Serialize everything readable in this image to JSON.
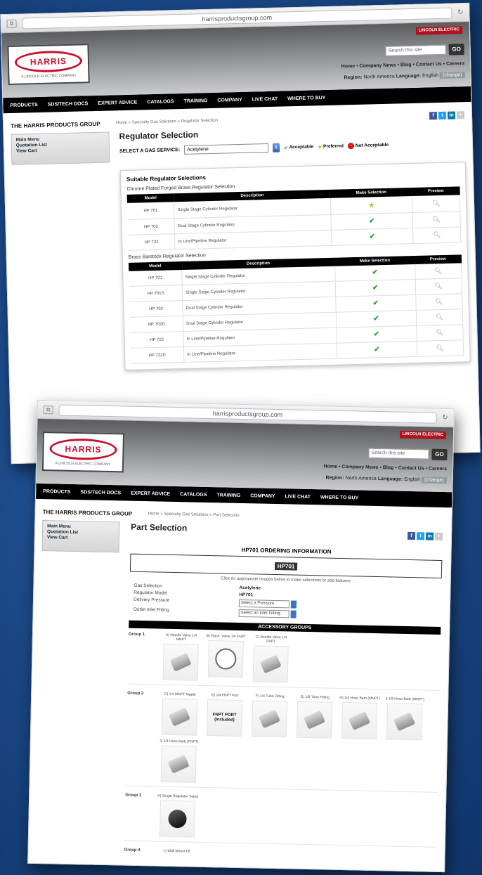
{
  "shot1": {
    "url": "harrisproductsgroup.com",
    "brand": {
      "logo": "HARRIS",
      "tagline": "A LINCOLN ELECTRIC COMPANY",
      "partner": "LINCOLN ELECTRIC"
    },
    "search": {
      "placeholder": "Search this site",
      "go": "GO"
    },
    "toplinks": "Home  •  Company News  •  Blog  •  Contact Us  •  Careers",
    "region": {
      "label": "Region:",
      "value": "North America",
      "lang_label": "Language:",
      "lang_value": "English",
      "change": "(change)"
    },
    "nav": [
      "PRODUCTS",
      "SDS/TECH DOCS",
      "EXPERT ADVICE",
      "CATALOGS",
      "TRAINING",
      "COMPANY",
      "LIVE CHAT",
      "WHERE TO BUY"
    ],
    "site_name": "THE HARRIS PRODUCTS GROUP",
    "breadcrumb": "Home » Specialty Gas Solutions » Regulator Selection",
    "sidebar": [
      "Main Menu",
      "Quotation List",
      "View Cart"
    ],
    "page_title": "Regulator Selection",
    "gas": {
      "label": "SELECT A GAS SERVICE:",
      "value": "Acetylene"
    },
    "legend": {
      "acceptable": "Acceptable",
      "preferred": "Preferred",
      "not_acceptable": "Not Acceptable"
    },
    "results_title": "Suitable Regulator Selections",
    "table_headers": [
      "Model",
      "Description",
      "Make Selection",
      "Preview"
    ],
    "sections": [
      {
        "title": "Chrome Plated Forged Brass Regulator Selection",
        "rows": [
          {
            "model": "HP 701",
            "desc": "Single Stage Cylinder Regulator",
            "mark": "preferred"
          },
          {
            "model": "HP 702",
            "desc": "Dual Stage Cylinder Regulator",
            "mark": "acceptable"
          },
          {
            "model": "HP 722",
            "desc": "In Line/Pipeline Regulator",
            "mark": "acceptable"
          }
        ]
      },
      {
        "title": "Brass Barstock Regulator Selection",
        "rows": [
          {
            "model": "HP 701",
            "desc": "Single Stage Cylinder Regulator",
            "mark": "acceptable"
          },
          {
            "model": "HP 701S",
            "desc": "Single Stage Cylinder Regulator",
            "mark": "acceptable"
          },
          {
            "model": "HP 702",
            "desc": "Dual Stage Cylinder Regulator",
            "mark": "acceptable"
          },
          {
            "model": "HP 702D",
            "desc": "Dual Stage Cylinder Regulator",
            "mark": "acceptable"
          },
          {
            "model": "HP 722",
            "desc": "In Line/Pipeline Regulator",
            "mark": "acceptable"
          },
          {
            "model": "HP 722D",
            "desc": "In Line/Pipeline Regulator",
            "mark": "acceptable"
          }
        ]
      }
    ]
  },
  "shot2": {
    "url": "harrisproductsgroup.com",
    "brand": {
      "logo": "HARRIS",
      "tagline": "A LINCOLN ELECTRIC COMPANY",
      "partner": "LINCOLN ELECTRIC"
    },
    "search": {
      "placeholder": "Search this site",
      "go": "GO"
    },
    "toplinks": "Home  •  Company News  •  Blog  •  Contact Us  •  Careers",
    "region": {
      "label": "Region:",
      "value": "North America",
      "lang_label": "Language:",
      "lang_value": "English",
      "change": "(change)"
    },
    "nav": [
      "PRODUCTS",
      "SDS/TECH DOCS",
      "EXPERT ADVICE",
      "CATALOGS",
      "TRAINING",
      "COMPANY",
      "LIVE CHAT",
      "WHERE TO BUY"
    ],
    "site_name": "THE HARRIS PRODUCTS GROUP",
    "breadcrumb": "Home » Specialty Gas Solutions » Part Selection",
    "sidebar": [
      "Main Menu",
      "Quotation List",
      "View Cart"
    ],
    "page_title": "Part Selection",
    "ordering_title": "HP701 ORDERING INFORMATION",
    "model_code": "HP701",
    "instructions": "Click on appropriate images below to make selections or add features",
    "options": [
      {
        "label": "Gas Selection",
        "value": "Acetylene"
      },
      {
        "label": "Regulator Model",
        "value": "HP701"
      },
      {
        "label": "Delivery Pressure",
        "select": "Select a Pressure"
      },
      {
        "label": "Outlet Inlet Fitting",
        "select": "Select an Inlet Fitting"
      }
    ],
    "accessory_title": "ACCESSORY GROUPS",
    "groups": [
      {
        "label": "Group 1",
        "items": [
          {
            "name": "A) Needle Valve 1/4 MNPT",
            "img": "valve"
          },
          {
            "name": "B) Flash. Valve 1/4 FNPT",
            "img": "gauge"
          },
          {
            "name": "C) Needle Valve 1/4 FNPT",
            "img": "valve"
          }
        ]
      },
      {
        "label": "Group 2",
        "items": [
          {
            "name": "D) 1/4 MNPT Nipple",
            "img": "nipple"
          },
          {
            "name": "E) 1/4 FNPT Port",
            "img": "fnpt",
            "thumb_text": "FNPT PORT (Included)"
          },
          {
            "name": "F) 1/4 Tube Fitting",
            "img": "tube"
          },
          {
            "name": "G) 1/8 Tube Fitting",
            "img": "tube"
          },
          {
            "name": "H) 1/4 Hose Barb (MNPT)",
            "img": "barb"
          },
          {
            "name": "I) 1/8 Hose Barb (MNPT)",
            "img": "barb"
          },
          {
            "name": "J) 1/4 Hose Barb (FNPT)",
            "img": "barb"
          }
        ]
      },
      {
        "label": "Group 3",
        "items": [
          {
            "name": "K) Single Regulator Stand",
            "img": "stand"
          }
        ]
      },
      {
        "label": "Group 4",
        "items": [
          {
            "name": "L) Wall Mount Kit",
            "img": "none"
          }
        ]
      }
    ]
  },
  "colors": {
    "nav_bg": "#000000",
    "brand_red": "#c8102e",
    "ok_green": "#2e9a2e",
    "select_blue": "#2c63b8",
    "background_blue": "#1d4c8c"
  }
}
